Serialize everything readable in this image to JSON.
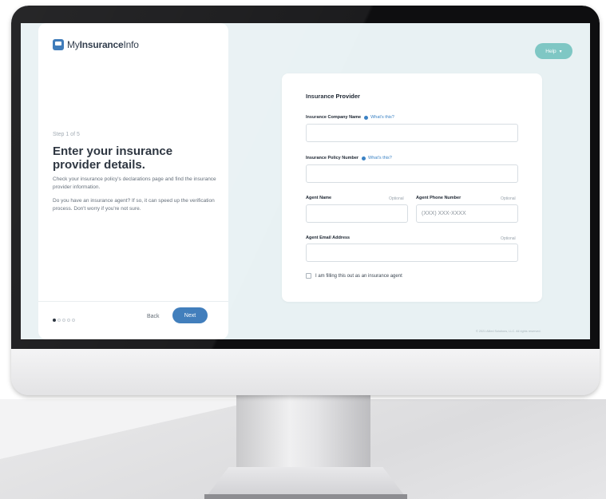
{
  "app": {
    "logo_text_prefix": "My",
    "logo_text_bold": "Insurance",
    "logo_text_suffix": "Info"
  },
  "left_panel": {
    "step": "Step 1 of 5",
    "heading": "Enter your insurance provider details.",
    "paragraph1": "Check your insurance policy's declarations page and find the insurance provider information.",
    "paragraph2": "Do you have an insurance agent? If so, it can speed up the verification process. Don't worry if you're not sure.",
    "progress": {
      "current": 1,
      "total": 5
    },
    "back_label": "Back",
    "next_label": "Next"
  },
  "header": {
    "help_label": "Help",
    "help_icon": "chevron-down-icon"
  },
  "form": {
    "title": "Insurance Provider",
    "company_name_label": "Insurance Company Name",
    "whats_this": "What's this?",
    "policy_number_label": "Insurance Policy Number",
    "agent_name_label": "Agent Name",
    "agent_phone_label": "Agent Phone Number",
    "agent_email_label": "Agent Email Address",
    "optional": "Optional",
    "phone_placeholder": "(XXX) XXX-XXXX",
    "agent_checkbox_label": "I am filling this out as an insurance agent"
  },
  "footer": {
    "copyright": "© 2021 Allied Solutions, LLC. All rights reserved."
  },
  "colors": {
    "primary": "#3576b8",
    "help": "#7fc7c4",
    "screen_bg": "#e8f1f3",
    "link": "#3b82c4"
  }
}
